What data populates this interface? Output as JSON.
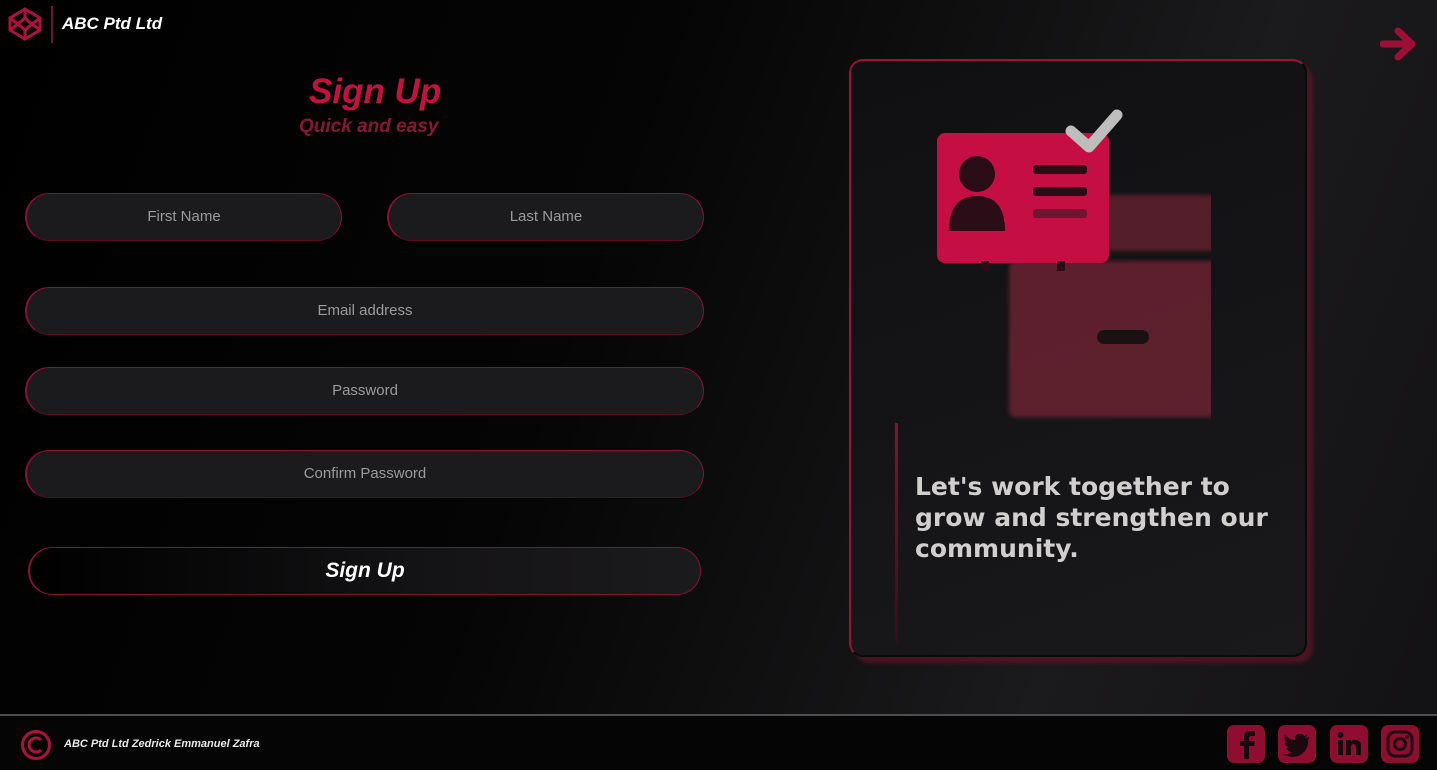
{
  "header": {
    "brand": "ABC Ptd Ltd",
    "logo_icon": "codepen-logo-icon",
    "next_icon": "arrow-right-icon"
  },
  "form": {
    "title": "Sign Up",
    "subtitle": "Quick and easy",
    "first_name_placeholder": "First Name",
    "last_name_placeholder": "Last Name",
    "email_placeholder": "Email address",
    "password_placeholder": "Password",
    "confirm_password_placeholder": "Confirm Password",
    "submit_label": "Sign Up"
  },
  "card": {
    "illustration_icon": "id-card-check-icon",
    "text": "Let's work together to grow and strengthen our community."
  },
  "footer": {
    "copyright_icon": "copyright-icon",
    "text": "ABC Ptd Ltd Zedrick Emmanuel Zafra",
    "social": [
      "facebook-icon",
      "twitter-icon",
      "linkedin-icon",
      "instagram-icon"
    ]
  },
  "colors": {
    "accent": "#c8103f",
    "accent_dark": "#8e0d31",
    "field_bg": "#1b1a1d"
  }
}
